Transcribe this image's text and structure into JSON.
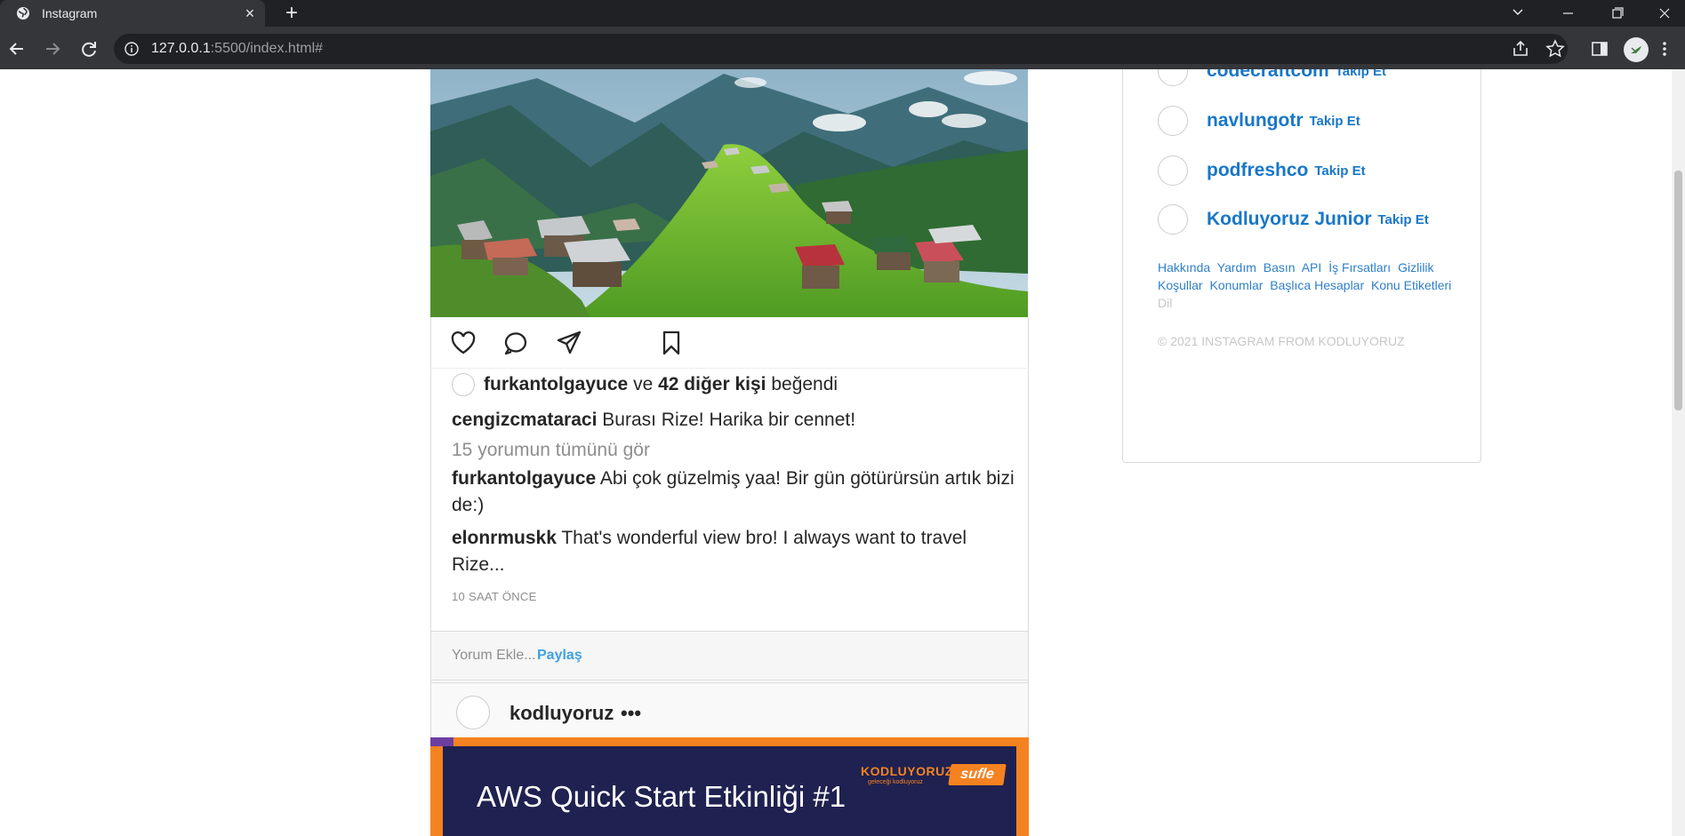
{
  "browser": {
    "tab_title": "Instagram",
    "new_tab": "+",
    "url_host": "127.0.0.1",
    "url_rest": ":5500/index.html#"
  },
  "feed": {
    "post1": {
      "liked_by_user": "furkantolgayuce",
      "liked_connector": "ve",
      "liked_others": "42 diğer kişi",
      "liked_suffix": "beğendi",
      "caption_user": "cengizcmataraci",
      "caption_text": "Burası Rize! Harika bir cennet!",
      "view_all_comments": "15 yorumun tümünü gör",
      "comments": [
        {
          "user": "furkantolgayuce",
          "text": "Abi çok güzelmiş yaa! Bir gün götürürsün artık bizi de:)"
        },
        {
          "user": "elonrmuskk",
          "text": "That's wonderful view bro! I always want to travel Rize..."
        }
      ],
      "timestamp": "10 SAAT ÖNCE",
      "add_comment_placeholder": "Yorum Ekle...",
      "share_label": "Paylaş"
    },
    "post2": {
      "username": "kodluyoruz",
      "more": "•••",
      "banner_title": "AWS Quick Start Etkinliği #1",
      "banner_brand": "KODLUYORUZ",
      "banner_brand_sub": "geleceği kodluyoruz",
      "banner_partner": "sufle"
    }
  },
  "sidebar": {
    "suggestions": [
      {
        "name": "codecraftcom",
        "follow": "Takip Et"
      },
      {
        "name": "navlungotr",
        "follow": "Takip Et"
      },
      {
        "name": "podfreshco",
        "follow": "Takip Et"
      },
      {
        "name": "Kodluyoruz Junior",
        "follow": "Takip Et"
      }
    ],
    "footer_links": [
      "Hakkında",
      "Yardım",
      "Basın",
      "API",
      "İş Fırsatları",
      "Gizlilik",
      "Koşullar",
      "Konumlar",
      "Başlıca Hesaplar",
      "Konu Etiketleri"
    ],
    "language": "Dil",
    "copyright": "© 2021 INSTAGRAM FROM KODLUYORUZ"
  }
}
